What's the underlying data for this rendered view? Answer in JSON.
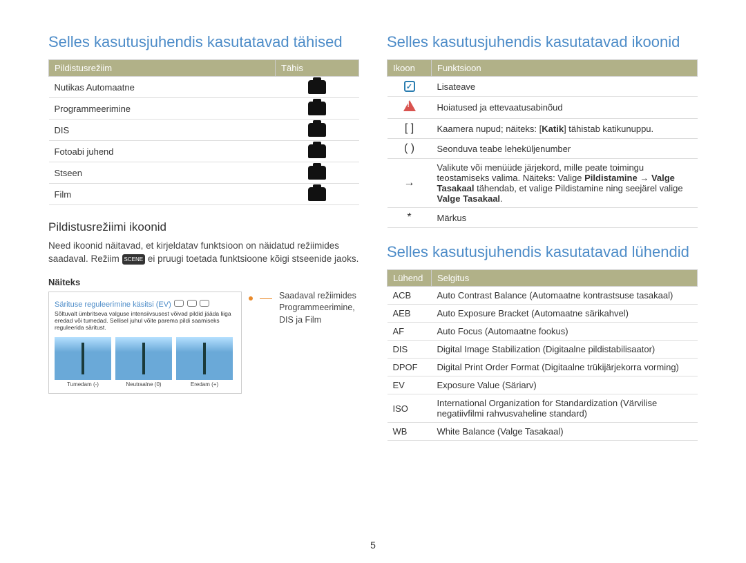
{
  "left": {
    "indicators_heading": "Selles kasutusjuhendis kasutatavad tähised",
    "indicators_headers": {
      "mode": "Pildistusrežiim",
      "indicator": "Tähis"
    },
    "indicators_rows": [
      {
        "mode": "Nutikas Automaatne",
        "icon_name": "smart-auto-camera-icon"
      },
      {
        "mode": "Programmeerimine",
        "icon_name": "program-camera-p-icon"
      },
      {
        "mode": "DIS",
        "icon_name": "dis-hand-icon"
      },
      {
        "mode": "Fotoabi juhend",
        "icon_name": "photo-help-camera-icon"
      },
      {
        "mode": "Stseen",
        "icon_name": "scene-clapper-icon"
      },
      {
        "mode": "Film",
        "icon_name": "movie-camera-icon"
      }
    ],
    "mode_icons_heading": "Pildistusrežiimi ikoonid",
    "mode_icons_body_pre": "Need ikoonid näitavad, et kirjeldatav funktsioon on näidatud režiimides saadaval. Režiim ",
    "mode_icons_body_post": " ei pruugi toetada funktsioone kõigi stseenide jaoks.",
    "example_label": "Näiteks",
    "example_box_title": "Särituse reguleerimine käsitsi (EV)",
    "example_box_desc": "Sõltuvalt ümbritseva valguse intensiivsusest võivad pildid jääda liiga eredad või tumedad. Sellisel juhul võite parema pildi saamiseks reguleerida säritust.",
    "example_images": [
      {
        "caption": "Tumedam (-)"
      },
      {
        "caption": "Neutraalne (0)"
      },
      {
        "caption": "Eredam (+)"
      }
    ],
    "callout_line1": "Saadaval režiimides",
    "callout_line2": "Programmeerimine,",
    "callout_line3": "DIS ja Film"
  },
  "right": {
    "icons_heading": "Selles kasutusjuhendis kasutatavad ikoonid",
    "icons_headers": {
      "icon": "Ikoon",
      "function": "Funktsioon"
    },
    "icons_rows": [
      {
        "icon_type": "info",
        "fn": "Lisateave"
      },
      {
        "icon_type": "warn",
        "fn": "Hoiatused ja ettevaatusabinõud"
      },
      {
        "icon_type": "brackets",
        "icon_text": "[ ]",
        "fn_html": "Kaamera nupud; näiteks: [<b>Katik</b>] tähistab katikunuppu."
      },
      {
        "icon_type": "parens",
        "icon_text": "( )",
        "fn": "Seonduva teabe leheküljenumber"
      },
      {
        "icon_type": "arrow",
        "icon_text": "→",
        "fn_html": "Valikute või menüüde järjekord, mille peate toimingu teostamiseks valima. Näiteks: Valige <b>Pildistamine</b> → <b>Valge Tasakaal</b> tähendab, et valige Pildistamine ning seejärel valige <b>Valge Tasakaal</b>."
      },
      {
        "icon_type": "star",
        "icon_text": "*",
        "fn": "Märkus"
      }
    ],
    "abbrev_heading": "Selles kasutusjuhendis kasutatavad lühendid",
    "abbrev_headers": {
      "abbrev": "Lühend",
      "def": "Selgitus"
    },
    "abbrev_rows": [
      {
        "abbrev": "ACB",
        "def": "Auto Contrast Balance (Automaatne kontrastsuse tasakaal)"
      },
      {
        "abbrev": "AEB",
        "def": "Auto Exposure Bracket (Automaatne särikahvel)"
      },
      {
        "abbrev": "AF",
        "def": "Auto Focus (Automaatne fookus)"
      },
      {
        "abbrev": "DIS",
        "def": "Digital Image Stabilization (Digitaalne pildistabilisaator)"
      },
      {
        "abbrev": "DPOF",
        "def": "Digital Print Order Format (Digitaalne trükijärjekorra vorming)"
      },
      {
        "abbrev": "EV",
        "def": "Exposure Value (Säriarv)"
      },
      {
        "abbrev": "ISO",
        "def": "International Organization for Standardization (Värvilise negatiivfilmi rahvusvaheline standard)"
      },
      {
        "abbrev": "WB",
        "def": "White Balance (Valge Tasakaal)"
      }
    ]
  },
  "page_number": "5"
}
